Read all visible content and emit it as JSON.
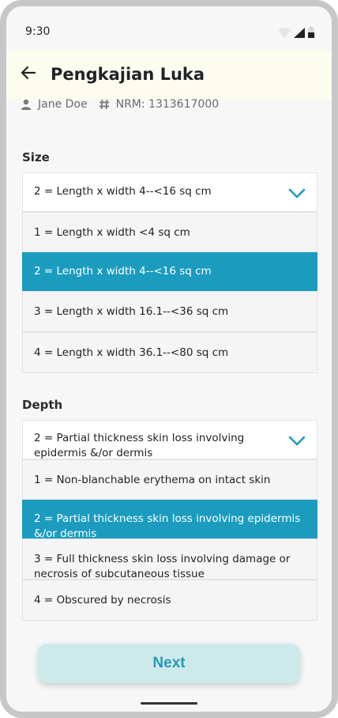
{
  "status_bar": {
    "time": "9:30"
  },
  "header": {
    "title": "Pengkajian Luka"
  },
  "patient": {
    "name": "Jane Doe",
    "nrm": "NRM: 1313617000"
  },
  "size": {
    "label": "Size",
    "selected": "2 = Length x width 4--<16 sq cm",
    "options": [
      "1 = Length x width <4 sq cm",
      "2 = Length x width 4--<16 sq cm",
      "3 = Length x width 16.1--<36 sq cm",
      "4 = Length x width 36.1--<80 sq cm"
    ]
  },
  "depth": {
    "label": "Depth",
    "selected": "2 = Partial thickness skin loss involving epidermis &/or dermis",
    "options": [
      "1 = Non-blanchable erythema on intact skin",
      "2 = Partial thickness skin loss involving epidermis &/or dermis",
      "3 = Full thickness skin loss involving damage or necrosis of subcutaneous tissue",
      "4 = Obscured by necrosis"
    ]
  },
  "actions": {
    "next_label": "Next"
  },
  "colors": {
    "accent": "#1b9cbf",
    "header_bg": "#fdfdef",
    "button_bg": "#cdeaeb",
    "button_text": "#2996b7"
  }
}
